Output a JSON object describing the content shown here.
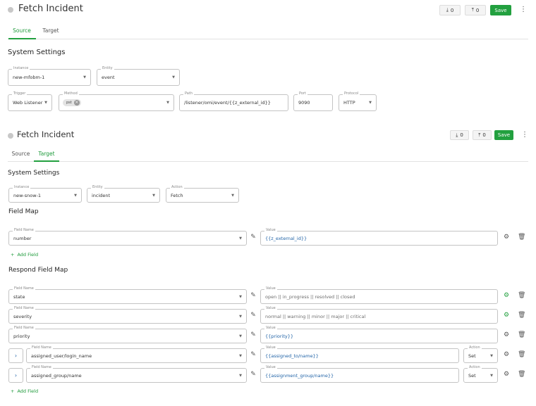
{
  "panel1": {
    "title": "Fetch Incident",
    "import_count": "0",
    "export_count": "0",
    "save_label": "Save",
    "tabs": [
      "Source",
      "Target"
    ],
    "section_title": "System Settings",
    "instance": {
      "label": "Instance",
      "value": "new-mfobm-1"
    },
    "entity": {
      "label": "Entity",
      "value": "event"
    },
    "trigger": {
      "label": "Trigger",
      "value": "Web Listener"
    },
    "method": {
      "label": "Method",
      "chip": "pst"
    },
    "path": {
      "label": "Path",
      "value": "/listener/omi/event/{{z_external_id}}"
    },
    "port": {
      "label": "Port",
      "value": "9090"
    },
    "protocol": {
      "label": "Protocol",
      "value": "HTTP"
    }
  },
  "panel2": {
    "title": "Fetch Incident",
    "import_count": "0",
    "export_count": "0",
    "save_label": "Save",
    "tabs": [
      "Source",
      "Target"
    ],
    "section_title": "System Settings",
    "instance": {
      "label": "Instance",
      "value": "new-snow-1"
    },
    "entity": {
      "label": "Entity",
      "value": "incident"
    },
    "action": {
      "label": "Action",
      "value": "Fetch"
    },
    "field_map_title": "Field Map",
    "field_name_label": "Field Name",
    "value_label": "Value",
    "action_label": "Action",
    "field_map": [
      {
        "field": "number",
        "value": "{{z_external_id}}"
      }
    ],
    "add_field_label": "Add Field",
    "respond_title": "Respond Field Map",
    "respond_rows": [
      {
        "field": "state",
        "value": "open || in_progress || resolved || closed"
      },
      {
        "field": "severity",
        "value": "normal || warning || minor || major || critical"
      },
      {
        "field": "priority",
        "value": "{{priority}}"
      },
      {
        "field": "assigned_user/login_name",
        "value": "{{assigned_to/name}}",
        "action": "Set"
      },
      {
        "field": "assigned_group/name",
        "value": "{{assignment_group/name}}",
        "action": "Set"
      }
    ]
  },
  "icons": {
    "download": "download-icon",
    "upload": "upload-icon",
    "menu": "more-vertical-icon",
    "edit": "pencil-icon",
    "settings": "gear-icon",
    "delete": "trash-icon",
    "add": "plus-icon",
    "expand": "chevron-right-icon"
  },
  "colors": {
    "accent": "#22a03f",
    "link": "#1f62a6"
  }
}
